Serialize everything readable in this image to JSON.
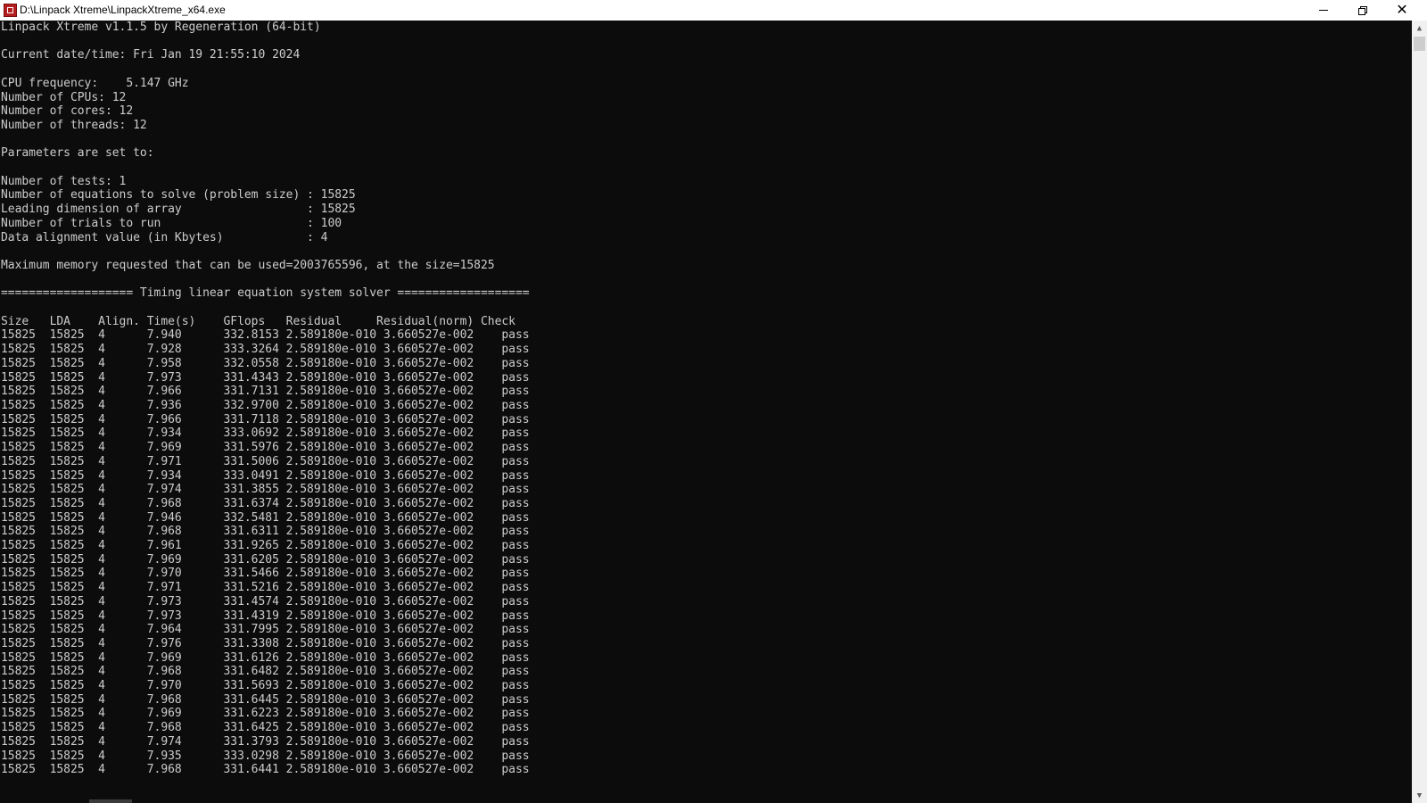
{
  "window": {
    "title": "D:\\Linpack Xtreme\\LinpackXtreme_x64.exe",
    "minimize_icon": "minimize-icon",
    "restore_icon": "restore-icon",
    "close_icon": "close-icon",
    "close_glyph": "✕"
  },
  "console": {
    "header_lines": [
      "Linpack Xtreme v1.1.5 by Regeneration (64-bit)",
      "",
      "Current date/time: Fri Jan 19 21:55:10 2024",
      "",
      "CPU frequency:    5.147 GHz",
      "Number of CPUs: 12",
      "Number of cores: 12",
      "Number of threads: 12",
      "",
      "Parameters are set to:",
      "",
      "Number of tests: 1",
      "Number of equations to solve (problem size) : 15825",
      "Leading dimension of array                  : 15825",
      "Number of trials to run                     : 100",
      "Data alignment value (in Kbytes)            : 4",
      "",
      "Maximum memory requested that can be used=2003765596, at the size=15825",
      "",
      "=================== Timing linear equation system solver ===================",
      ""
    ],
    "table_header": "Size   LDA    Align. Time(s)    GFlops   Residual     Residual(norm) Check",
    "results": [
      {
        "size": "15825",
        "lda": "15825",
        "align": "4",
        "time": "7.940",
        "gflops": "332.8153",
        "residual": "2.589180e-010",
        "residual_norm": "3.660527e-002",
        "check": "pass"
      },
      {
        "size": "15825",
        "lda": "15825",
        "align": "4",
        "time": "7.928",
        "gflops": "333.3264",
        "residual": "2.589180e-010",
        "residual_norm": "3.660527e-002",
        "check": "pass"
      },
      {
        "size": "15825",
        "lda": "15825",
        "align": "4",
        "time": "7.958",
        "gflops": "332.0558",
        "residual": "2.589180e-010",
        "residual_norm": "3.660527e-002",
        "check": "pass"
      },
      {
        "size": "15825",
        "lda": "15825",
        "align": "4",
        "time": "7.973",
        "gflops": "331.4343",
        "residual": "2.589180e-010",
        "residual_norm": "3.660527e-002",
        "check": "pass"
      },
      {
        "size": "15825",
        "lda": "15825",
        "align": "4",
        "time": "7.966",
        "gflops": "331.7131",
        "residual": "2.589180e-010",
        "residual_norm": "3.660527e-002",
        "check": "pass"
      },
      {
        "size": "15825",
        "lda": "15825",
        "align": "4",
        "time": "7.936",
        "gflops": "332.9700",
        "residual": "2.589180e-010",
        "residual_norm": "3.660527e-002",
        "check": "pass"
      },
      {
        "size": "15825",
        "lda": "15825",
        "align": "4",
        "time": "7.966",
        "gflops": "331.7118",
        "residual": "2.589180e-010",
        "residual_norm": "3.660527e-002",
        "check": "pass"
      },
      {
        "size": "15825",
        "lda": "15825",
        "align": "4",
        "time": "7.934",
        "gflops": "333.0692",
        "residual": "2.589180e-010",
        "residual_norm": "3.660527e-002",
        "check": "pass"
      },
      {
        "size": "15825",
        "lda": "15825",
        "align": "4",
        "time": "7.969",
        "gflops": "331.5976",
        "residual": "2.589180e-010",
        "residual_norm": "3.660527e-002",
        "check": "pass"
      },
      {
        "size": "15825",
        "lda": "15825",
        "align": "4",
        "time": "7.971",
        "gflops": "331.5006",
        "residual": "2.589180e-010",
        "residual_norm": "3.660527e-002",
        "check": "pass"
      },
      {
        "size": "15825",
        "lda": "15825",
        "align": "4",
        "time": "7.934",
        "gflops": "333.0491",
        "residual": "2.589180e-010",
        "residual_norm": "3.660527e-002",
        "check": "pass"
      },
      {
        "size": "15825",
        "lda": "15825",
        "align": "4",
        "time": "7.974",
        "gflops": "331.3855",
        "residual": "2.589180e-010",
        "residual_norm": "3.660527e-002",
        "check": "pass"
      },
      {
        "size": "15825",
        "lda": "15825",
        "align": "4",
        "time": "7.968",
        "gflops": "331.6374",
        "residual": "2.589180e-010",
        "residual_norm": "3.660527e-002",
        "check": "pass"
      },
      {
        "size": "15825",
        "lda": "15825",
        "align": "4",
        "time": "7.946",
        "gflops": "332.5481",
        "residual": "2.589180e-010",
        "residual_norm": "3.660527e-002",
        "check": "pass"
      },
      {
        "size": "15825",
        "lda": "15825",
        "align": "4",
        "time": "7.968",
        "gflops": "331.6311",
        "residual": "2.589180e-010",
        "residual_norm": "3.660527e-002",
        "check": "pass"
      },
      {
        "size": "15825",
        "lda": "15825",
        "align": "4",
        "time": "7.961",
        "gflops": "331.9265",
        "residual": "2.589180e-010",
        "residual_norm": "3.660527e-002",
        "check": "pass"
      },
      {
        "size": "15825",
        "lda": "15825",
        "align": "4",
        "time": "7.969",
        "gflops": "331.6205",
        "residual": "2.589180e-010",
        "residual_norm": "3.660527e-002",
        "check": "pass"
      },
      {
        "size": "15825",
        "lda": "15825",
        "align": "4",
        "time": "7.970",
        "gflops": "331.5466",
        "residual": "2.589180e-010",
        "residual_norm": "3.660527e-002",
        "check": "pass"
      },
      {
        "size": "15825",
        "lda": "15825",
        "align": "4",
        "time": "7.971",
        "gflops": "331.5216",
        "residual": "2.589180e-010",
        "residual_norm": "3.660527e-002",
        "check": "pass"
      },
      {
        "size": "15825",
        "lda": "15825",
        "align": "4",
        "time": "7.973",
        "gflops": "331.4574",
        "residual": "2.589180e-010",
        "residual_norm": "3.660527e-002",
        "check": "pass"
      },
      {
        "size": "15825",
        "lda": "15825",
        "align": "4",
        "time": "7.973",
        "gflops": "331.4319",
        "residual": "2.589180e-010",
        "residual_norm": "3.660527e-002",
        "check": "pass"
      },
      {
        "size": "15825",
        "lda": "15825",
        "align": "4",
        "time": "7.964",
        "gflops": "331.7995",
        "residual": "2.589180e-010",
        "residual_norm": "3.660527e-002",
        "check": "pass"
      },
      {
        "size": "15825",
        "lda": "15825",
        "align": "4",
        "time": "7.976",
        "gflops": "331.3308",
        "residual": "2.589180e-010",
        "residual_norm": "3.660527e-002",
        "check": "pass"
      },
      {
        "size": "15825",
        "lda": "15825",
        "align": "4",
        "time": "7.969",
        "gflops": "331.6126",
        "residual": "2.589180e-010",
        "residual_norm": "3.660527e-002",
        "check": "pass"
      },
      {
        "size": "15825",
        "lda": "15825",
        "align": "4",
        "time": "7.968",
        "gflops": "331.6482",
        "residual": "2.589180e-010",
        "residual_norm": "3.660527e-002",
        "check": "pass"
      },
      {
        "size": "15825",
        "lda": "15825",
        "align": "4",
        "time": "7.970",
        "gflops": "331.5693",
        "residual": "2.589180e-010",
        "residual_norm": "3.660527e-002",
        "check": "pass"
      },
      {
        "size": "15825",
        "lda": "15825",
        "align": "4",
        "time": "7.968",
        "gflops": "331.6445",
        "residual": "2.589180e-010",
        "residual_norm": "3.660527e-002",
        "check": "pass"
      },
      {
        "size": "15825",
        "lda": "15825",
        "align": "4",
        "time": "7.969",
        "gflops": "331.6223",
        "residual": "2.589180e-010",
        "residual_norm": "3.660527e-002",
        "check": "pass"
      },
      {
        "size": "15825",
        "lda": "15825",
        "align": "4",
        "time": "7.968",
        "gflops": "331.6425",
        "residual": "2.589180e-010",
        "residual_norm": "3.660527e-002",
        "check": "pass"
      },
      {
        "size": "15825",
        "lda": "15825",
        "align": "4",
        "time": "7.974",
        "gflops": "331.3793",
        "residual": "2.589180e-010",
        "residual_norm": "3.660527e-002",
        "check": "pass"
      },
      {
        "size": "15825",
        "lda": "15825",
        "align": "4",
        "time": "7.935",
        "gflops": "333.0298",
        "residual": "2.589180e-010",
        "residual_norm": "3.660527e-002",
        "check": "pass"
      },
      {
        "size": "15825",
        "lda": "15825",
        "align": "4",
        "time": "7.968",
        "gflops": "331.6441",
        "residual": "2.589180e-010",
        "residual_norm": "3.660527e-002",
        "check": "pass"
      }
    ]
  },
  "scrollbar": {
    "up_arrow": "▲",
    "down_arrow": "▼",
    "up_icon": "scroll-up-arrow-icon",
    "down_icon": "scroll-down-arrow-icon"
  },
  "colors": {
    "console_background": "#0c0c0c",
    "console_text": "#cccccc",
    "titlebar_background": "#ffffff",
    "scrollbar_track": "#f0f0f0"
  }
}
